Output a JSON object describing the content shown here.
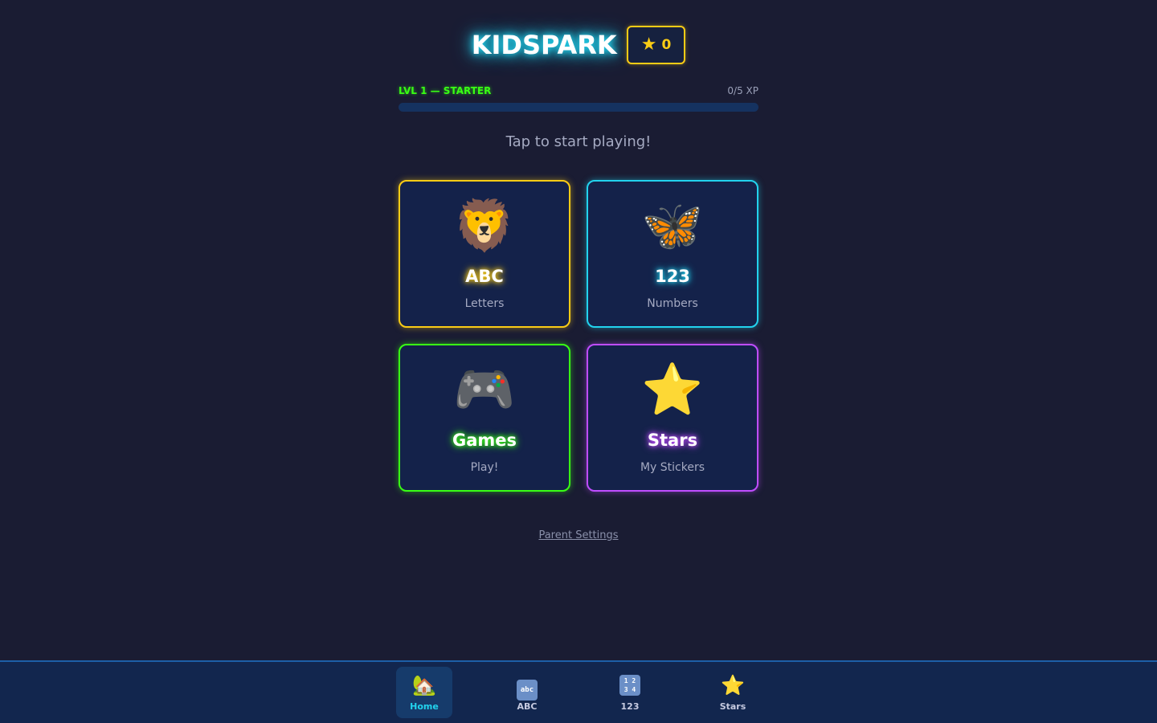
{
  "app": {
    "title": "KIDSPARK",
    "stars_count": "0"
  },
  "level": {
    "label": "LVL 1 — STARTER",
    "xp_text": "0/5 XP",
    "progress_fraction": 0
  },
  "tagline": "Tap to start playing!",
  "cards": [
    {
      "icon": "lion-icon",
      "title": "ABC",
      "subtitle": "Letters",
      "color": "#facc15"
    },
    {
      "icon": "butterfly-icon",
      "title": "123",
      "subtitle": "Numbers",
      "color": "#22d3ee"
    },
    {
      "icon": "gamepad-icon",
      "title": "Games",
      "subtitle": "Play!",
      "color": "#39ff14"
    },
    {
      "icon": "star-icon",
      "title": "Stars",
      "subtitle": "My Stickers",
      "color": "#c04dff"
    }
  ],
  "parent_settings_label": "Parent Settings",
  "nav": {
    "items": [
      {
        "icon": "home-icon",
        "label": "Home",
        "active": true
      },
      {
        "icon": "abc-icon",
        "label": "ABC",
        "active": false
      },
      {
        "icon": "numbers-icon",
        "label": "123",
        "active": false
      },
      {
        "icon": "star-icon",
        "label": "Stars",
        "active": false
      }
    ]
  },
  "colors": {
    "background": "#1a1c33",
    "accent_cyan": "#22d3ee",
    "accent_yellow": "#facc15",
    "accent_green": "#39ff14",
    "accent_purple": "#c04dff"
  }
}
